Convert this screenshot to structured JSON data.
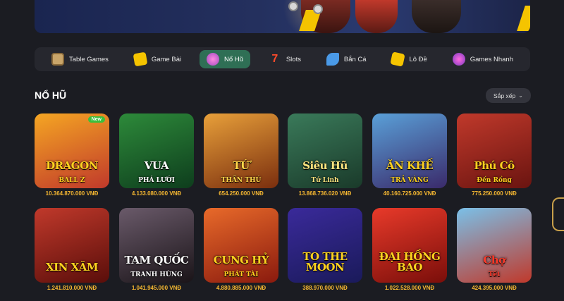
{
  "nav": {
    "items": [
      {
        "label": "Table Games",
        "icon": "dice-icon",
        "active": false
      },
      {
        "label": "Game Bài",
        "icon": "cards-icon",
        "active": false
      },
      {
        "label": "Nổ Hũ",
        "icon": "jackpot-pot-icon",
        "active": true
      },
      {
        "label": "Slots",
        "icon": "slot-seven-icon",
        "active": false
      },
      {
        "label": "Bắn Cá",
        "icon": "fish-icon",
        "active": false
      },
      {
        "label": "Lô Đề",
        "icon": "lottery-ticket-icon",
        "active": false
      },
      {
        "label": "Games Nhanh",
        "icon": "rocket-icon",
        "active": false
      }
    ],
    "active_color": "#2f6f55"
  },
  "section": {
    "title": "NỔ HŨ",
    "sort_label": "Sắp xếp"
  },
  "games": [
    {
      "title": "DRAGON",
      "subtitle": "BALL Z",
      "jackpot": "10.364.870.000 VNĐ",
      "badge": "New",
      "bg": [
        "#f5a623",
        "#c0392b"
      ],
      "text_color": "#ffd21f"
    },
    {
      "title": "VUA",
      "subtitle": "PHÁ LƯỚI",
      "jackpot": "4.133.080.000 VNĐ",
      "badge": "",
      "bg": [
        "#2d8a3a",
        "#0e3d1d"
      ],
      "text_color": "#ffffff"
    },
    {
      "title": "TỨ",
      "subtitle": "THẦN THÚ",
      "jackpot": "654.250.000 VNĐ",
      "badge": "",
      "bg": [
        "#e8a03a",
        "#7a2e0e"
      ],
      "text_color": "#ffd94a"
    },
    {
      "title": "Siêu Hũ",
      "subtitle": "Tứ Linh",
      "jackpot": "13.868.736.020 VNĐ",
      "badge": "",
      "bg": [
        "#3a7a5a",
        "#1a3a2a"
      ],
      "text_color": "#ffe680"
    },
    {
      "title": "ĂN KHẾ",
      "subtitle": "TRẢ VÀNG",
      "jackpot": "40.160.725.000 VNĐ",
      "badge": "",
      "bg": [
        "#5aa0d8",
        "#3a2a6a"
      ],
      "text_color": "#ffd21f"
    },
    {
      "title": "Phú Cô",
      "subtitle": "Đến Rồng",
      "jackpot": "775.250.000 VNĐ",
      "badge": "",
      "bg": [
        "#c0392b",
        "#6a1410"
      ],
      "text_color": "#ffd21f"
    },
    {
      "title": "XIN XĂM",
      "subtitle": "",
      "jackpot": "1.241.810.000 VNĐ",
      "badge": "",
      "bg": [
        "#c0392b",
        "#5a0e0a"
      ],
      "text_color": "#ffd21f"
    },
    {
      "title": "TAM QUỐC",
      "subtitle": "TRANH HÙNG",
      "jackpot": "1.041.945.000 VNĐ",
      "badge": "",
      "bg": [
        "#6a5a6a",
        "#1a1418"
      ],
      "text_color": "#ffffff"
    },
    {
      "title": "CUNG HỶ",
      "subtitle": "PHÁT TÀI",
      "jackpot": "4.880.885.000 VNĐ",
      "badge": "",
      "bg": [
        "#e86a2a",
        "#8a1a0e"
      ],
      "text_color": "#ffd21f"
    },
    {
      "title": "TO THE MOON",
      "subtitle": "",
      "jackpot": "388.970.000 VNĐ",
      "badge": "",
      "bg": [
        "#3a2a9a",
        "#1a1a5a"
      ],
      "text_color": "#ffd21f"
    },
    {
      "title": "ĐẠI HỒNG BAO",
      "subtitle": "",
      "jackpot": "1.022.528.000 VNĐ",
      "badge": "",
      "bg": [
        "#e83a2a",
        "#7a0e0a"
      ],
      "text_color": "#ffd21f"
    },
    {
      "title": "Chợ",
      "subtitle": "Tết",
      "jackpot": "424.395.000 VNĐ",
      "badge": "",
      "bg": [
        "#7ac0e8",
        "#c0392b"
      ],
      "text_color": "#ff3a2a"
    }
  ]
}
